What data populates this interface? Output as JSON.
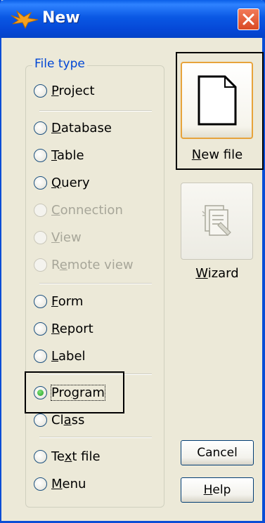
{
  "window": {
    "title": "New"
  },
  "file_type": {
    "group_label": "File type",
    "options": [
      {
        "label": "Project",
        "mnemonic": "P",
        "rest": "roject",
        "enabled": true,
        "selected": false
      },
      {
        "label": "Database",
        "mnemonic": "D",
        "rest": "atabase",
        "enabled": true,
        "selected": false
      },
      {
        "label": "Table",
        "mnemonic": "T",
        "rest": "able",
        "enabled": true,
        "selected": false
      },
      {
        "label": "Query",
        "mnemonic": "Q",
        "rest": "uery",
        "enabled": true,
        "selected": false
      },
      {
        "label": "Connection",
        "mnemonic": "C",
        "rest": "onnection",
        "enabled": false,
        "selected": false
      },
      {
        "label": "View",
        "mnemonic": "V",
        "rest": "iew",
        "enabled": false,
        "selected": false
      },
      {
        "label": "Remote view",
        "mnemonic": "e",
        "pre": "R",
        "rest": "mote view",
        "enabled": false,
        "selected": false
      },
      {
        "label": "Form",
        "mnemonic": "F",
        "rest": "orm",
        "enabled": true,
        "selected": false
      },
      {
        "label": "Report",
        "mnemonic": "R",
        "rest": "eport",
        "enabled": true,
        "selected": false
      },
      {
        "label": "Label",
        "mnemonic": "L",
        "rest": "abel",
        "enabled": true,
        "selected": false
      },
      {
        "label": "Program",
        "mnemonic": "g",
        "pre": "Pro",
        "rest": "ram",
        "enabled": true,
        "selected": true
      },
      {
        "label": "Class",
        "mnemonic": "a",
        "pre": "Cl",
        "rest": "ss",
        "enabled": true,
        "selected": false
      },
      {
        "label": "Text file",
        "mnemonic": "x",
        "pre": "Te",
        "rest": "t file",
        "enabled": true,
        "selected": false
      },
      {
        "label": "Menu",
        "mnemonic": "M",
        "rest": "enu",
        "enabled": true,
        "selected": false
      }
    ]
  },
  "buttons": {
    "new_file": {
      "label": "New file",
      "mnemonic": "N",
      "rest": "ew file"
    },
    "wizard": {
      "label": "Wizard",
      "mnemonic": "W",
      "rest": "izard"
    },
    "cancel": "Cancel",
    "help": {
      "label": "Help",
      "mnemonic": "H",
      "rest": "elp"
    }
  },
  "icons": {
    "app": "visual-foxpro-fox-icon",
    "close": "close-icon",
    "new_file": "blank-page-icon",
    "wizard": "wizard-icon"
  }
}
